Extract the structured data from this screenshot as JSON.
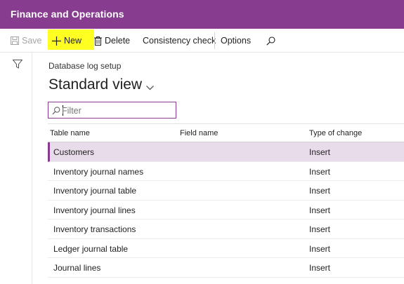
{
  "app": {
    "title": "Finance and Operations"
  },
  "toolbar": {
    "save_label": "Save",
    "new_label": "New",
    "delete_label": "Delete",
    "consistency_label": "Consistency check",
    "options_label": "Options"
  },
  "page": {
    "caption": "Database log setup",
    "view_name": "Standard view"
  },
  "filter": {
    "placeholder": "Filter"
  },
  "grid": {
    "columns": [
      "Table name",
      "Field name",
      "Type of change"
    ],
    "rows": [
      {
        "table": "Customers",
        "field": "",
        "change": "Insert",
        "selected": true
      },
      {
        "table": "Inventory journal names",
        "field": "",
        "change": "Insert"
      },
      {
        "table": "Inventory journal table",
        "field": "",
        "change": "Insert"
      },
      {
        "table": "Inventory journal lines",
        "field": "",
        "change": "Insert"
      },
      {
        "table": "Inventory transactions",
        "field": "",
        "change": "Insert"
      },
      {
        "table": "Ledger journal table",
        "field": "",
        "change": "Insert"
      },
      {
        "table": "Journal lines",
        "field": "",
        "change": "Insert"
      }
    ]
  },
  "colors": {
    "brand": "#873c8f",
    "highlight": "#ffff21",
    "selected_row": "#e9dcea"
  },
  "icons": [
    "save-icon",
    "plus-icon",
    "trash-icon",
    "search-icon",
    "filter-funnel-icon",
    "chevron-down-icon"
  ]
}
